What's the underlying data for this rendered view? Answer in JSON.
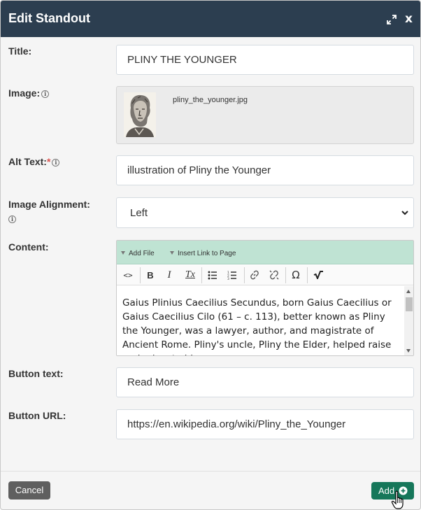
{
  "dialog": {
    "title": "Edit Standout",
    "close_label": "x"
  },
  "form": {
    "title_label": "Title:",
    "title_value": "PLINY THE YOUNGER",
    "image_label": "Image:",
    "image_filename": "pliny_the_younger.jpg",
    "alt_label": "Alt Text:",
    "alt_required_mark": "*",
    "alt_value": "illustration of Pliny the Younger",
    "alignment_label": "Image Alignment:",
    "alignment_value": "Left",
    "content_label": "Content:",
    "button_text_label": "Button text:",
    "button_text_value": "Read More",
    "button_url_label": "Button URL:",
    "button_url_value": "https://en.wikipedia.org/wiki/Pliny_the_Younger"
  },
  "editor": {
    "add_file": "Add File",
    "insert_link": "Insert Link to Page",
    "toolbar": {
      "source": "<>",
      "bold": "B",
      "italic": "I",
      "clear_format": "Tx",
      "omega": "Ω"
    },
    "content": "Gaius Plinius Caecilius Secundus, born Gaius Caecilius or Gaius Caecilius Cilo (61 – c. 113), better known as Pliny the Younger, was a lawyer, author, and magistrate of Ancient Rome. Pliny's uncle, Pliny the Elder, helped raise and educate him."
  },
  "footer": {
    "cancel_label": "Cancel",
    "add_label": "Add"
  },
  "colors": {
    "header_bg": "#2c3e50",
    "editor_bar_bg": "#bfe3d3",
    "add_button": "#16775a",
    "cancel_button": "#5f5f5f",
    "required": "#d9534f"
  }
}
